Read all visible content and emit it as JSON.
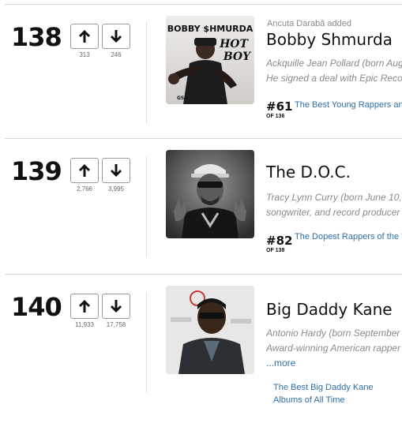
{
  "items": [
    {
      "rank": "138",
      "up_count": "313",
      "down_count": "246",
      "added_by": "Ancuta Darabă added",
      "name": "Bobby Shmurda",
      "desc_line1": "Ackquille Jean Pollard (born Aug",
      "desc_line2": "He signed a deal with Epic Reco",
      "list_rank": "#61",
      "list_of": "OF 136",
      "list_title": "The Best Young Rappers an",
      "image_text_1": "BOBBY $HMURDA",
      "image_text_2": "HOT",
      "image_text_3": "BOY",
      "image_text_4": "GS9"
    },
    {
      "rank": "139",
      "up_count": "2,766",
      "down_count": "3,995",
      "name": "The D.O.C.",
      "desc_line1": "Tracy Lynn Curry (born June 10,",
      "desc_line2": "songwriter, and record producer",
      "list_rank": "#82",
      "list_of": "OF 138",
      "list_title": "The Dopest Rappers of the '"
    },
    {
      "rank": "140",
      "up_count": "11,933",
      "down_count": "17,758",
      "name": "Big Daddy Kane",
      "desc_line1": "Antonio Hardy (born September",
      "desc_line2": "Award-winning American rapper",
      "more": "...more",
      "list_title": "The Best Big Daddy Kane Albums of All Time"
    }
  ],
  "icons": {
    "upvote": "arrow-up-icon",
    "downvote": "arrow-down-icon"
  },
  "colors": {
    "link": "#2f6ea3",
    "muted": "#8a8a8a",
    "divider": "#d8d8d8"
  }
}
